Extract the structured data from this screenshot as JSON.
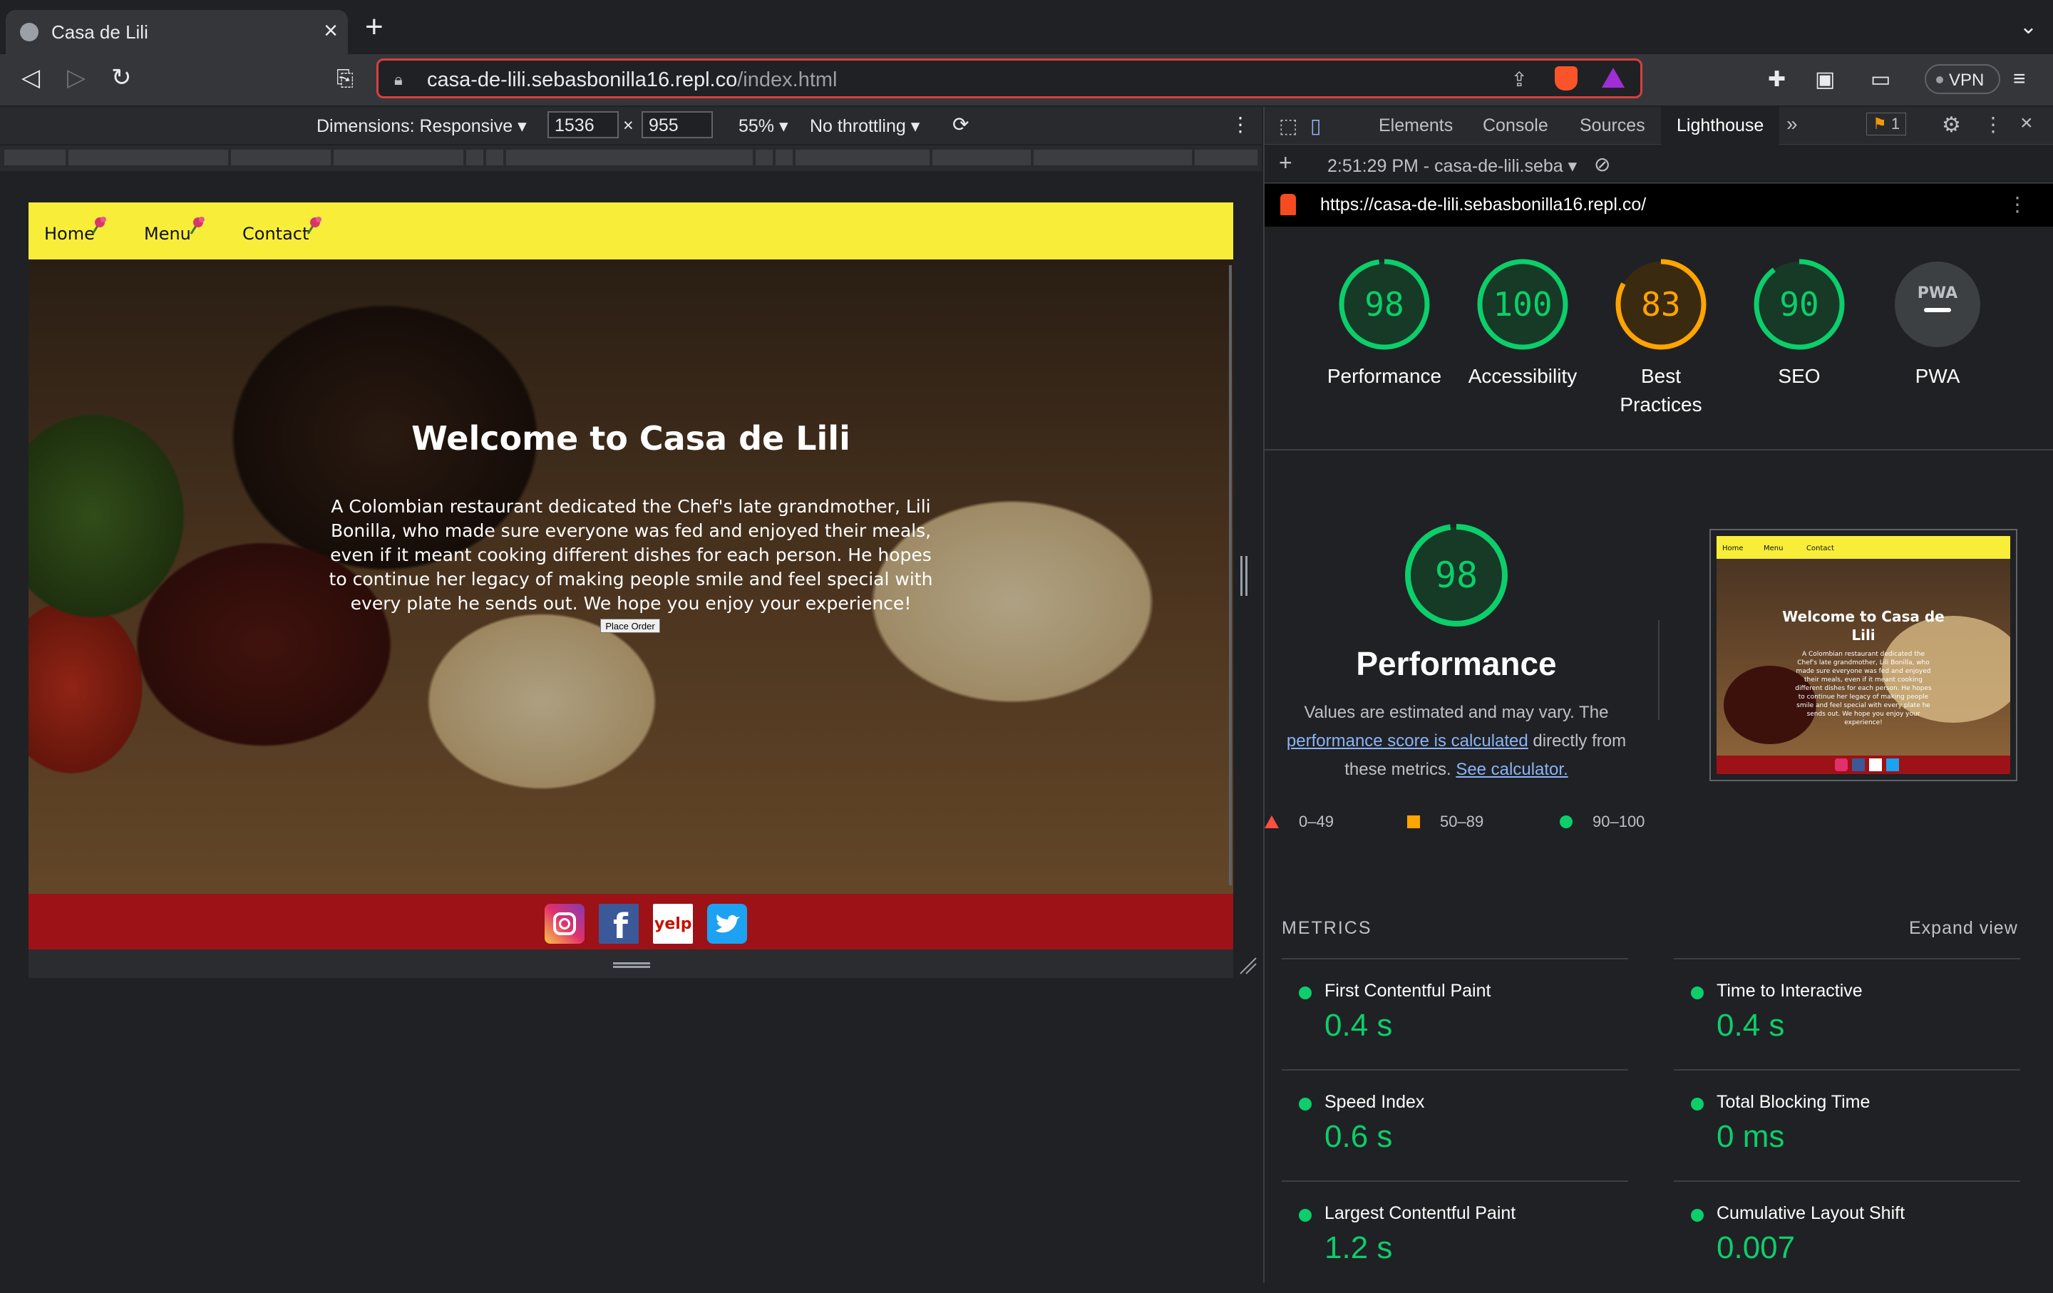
{
  "browser": {
    "tab_title": "Casa de Lili",
    "url_host": "casa-de-lili.sebasbonilla16.repl.co",
    "url_path": "/index.html",
    "vpn_label": "VPN"
  },
  "device_toolbar": {
    "dimensions_label": "Dimensions: Responsive",
    "width": "1536",
    "height": "955",
    "times": "×",
    "zoom": "55%",
    "throttling": "No throttling"
  },
  "site": {
    "nav": [
      {
        "label": "Home"
      },
      {
        "label": "Menu"
      },
      {
        "label": "Contact"
      }
    ],
    "hero_title": "Welcome to Casa de Lili",
    "hero_text": "A Colombian restaurant dedicated the Chef's late grandmother, Lili Bonilla, who made sure everyone was fed and enjoyed their meals, even if it meant cooking different dishes for each person. He hopes to continue her legacy of making people smile and feel special with every plate he sends out. We hope you enjoy your experience!",
    "place_order": "Place Order",
    "social": [
      "instagram-icon",
      "facebook-icon",
      "yelp-icon",
      "twitter-icon"
    ]
  },
  "devtools": {
    "tabs": [
      "Elements",
      "Console",
      "Sources",
      "Lighthouse"
    ],
    "active_tab": "Lighthouse",
    "issues_count": "1",
    "report_time": "2:51:29 PM - casa-de-lili.seba",
    "report_url": "https://casa-de-lili.sebasbonilla16.repl.co/",
    "scores": [
      {
        "label": "Performance",
        "score": 98,
        "color": "#0cce6b"
      },
      {
        "label": "Accessibility",
        "score": 100,
        "color": "#0cce6b"
      },
      {
        "label": "Best Practices",
        "score": 83,
        "color": "#ffa400"
      },
      {
        "label": "SEO",
        "score": 90,
        "color": "#0cce6b"
      },
      {
        "label": "PWA",
        "score": null,
        "color": "#9aa0a6"
      }
    ],
    "pwa_badge": "PWA",
    "perf_score": "98",
    "perf_title": "Performance",
    "perf_desc_1": "Values are estimated and may vary. The",
    "perf_link_1": "performance score is calculated",
    "perf_desc_2": "directly from",
    "perf_desc_3": "these metrics.",
    "perf_link_2": "See calculator.",
    "legend": [
      {
        "range": "0–49",
        "color": "#ff4e42"
      },
      {
        "range": "50–89",
        "color": "#ffa400"
      },
      {
        "range": "90–100",
        "color": "#0cce6b"
      }
    ],
    "thumbnail": {
      "nav": [
        "Home",
        "Menu",
        "Contact"
      ],
      "title": "Welcome to Casa de Lili",
      "text": "A Colombian restaurant dedicated the Chef's late grandmother, Lili Bonilla, who made sure everyone was fed and enjoyed their meals, even if it meant cooking different dishes for each person. He hopes to continue her legacy of making people smile and feel special with every plate he sends out. We hope you enjoy your experience!"
    },
    "metrics_title": "METRICS",
    "expand_view": "Expand view",
    "metrics": [
      {
        "name": "First Contentful Paint",
        "value": "0.4 s"
      },
      {
        "name": "Time to Interactive",
        "value": "0.4 s"
      },
      {
        "name": "Speed Index",
        "value": "0.6 s"
      },
      {
        "name": "Total Blocking Time",
        "value": "0 ms"
      },
      {
        "name": "Largest Contentful Paint",
        "value": "1.2 s"
      },
      {
        "name": "Cumulative Layout Shift",
        "value": "0.007"
      }
    ]
  }
}
